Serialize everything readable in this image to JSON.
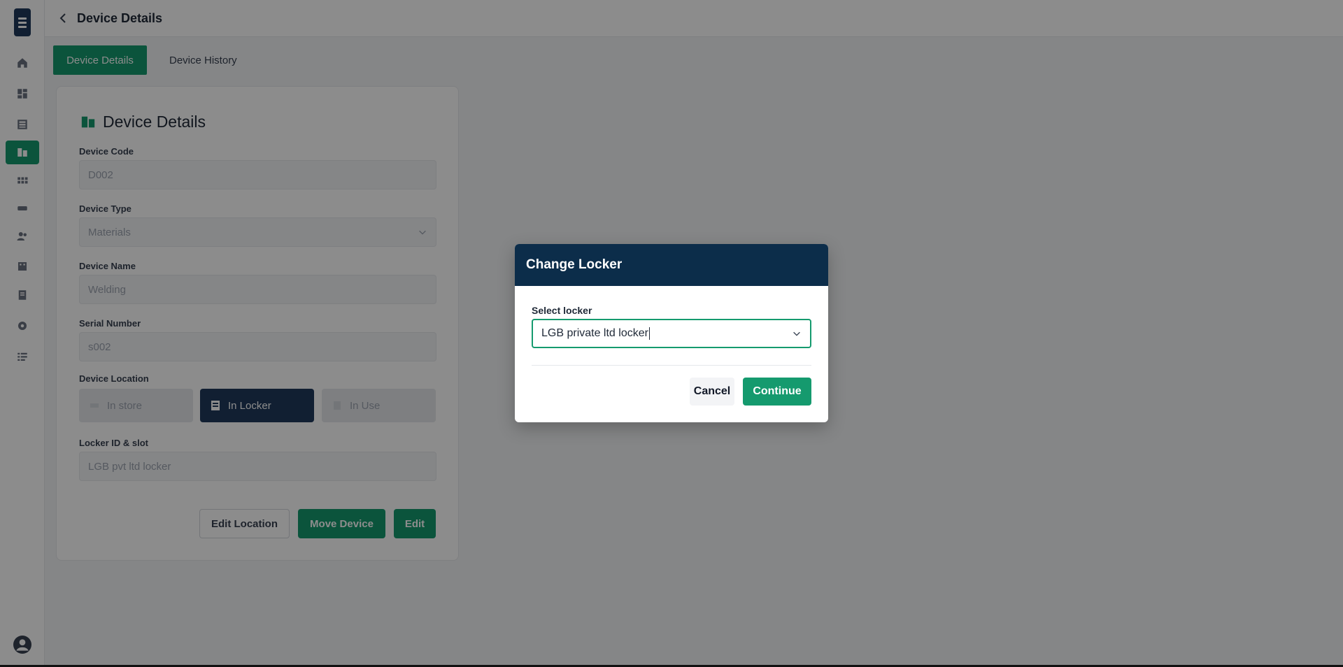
{
  "header": {
    "title": "Device Details"
  },
  "tabs": [
    {
      "label": "Device Details",
      "active": true
    },
    {
      "label": "Device History",
      "active": false
    }
  ],
  "sidebar": {
    "items": [
      {
        "icon": "home-icon"
      },
      {
        "icon": "dashboard-icon"
      },
      {
        "icon": "locker-icon"
      },
      {
        "icon": "devices-icon",
        "active": true
      },
      {
        "icon": "grid-icon"
      },
      {
        "icon": "card-icon"
      },
      {
        "icon": "users-icon"
      },
      {
        "icon": "building-icon"
      },
      {
        "icon": "document-icon"
      },
      {
        "icon": "gear-icon"
      },
      {
        "icon": "list-icon"
      }
    ]
  },
  "card": {
    "title": "Device Details",
    "fields": {
      "device_code": {
        "label": "Device Code",
        "value": "D002"
      },
      "device_type": {
        "label": "Device Type",
        "value": "Materials"
      },
      "device_name": {
        "label": "Device Name",
        "value": "Welding"
      },
      "serial_number": {
        "label": "Serial Number",
        "value": "s002"
      },
      "device_location": {
        "label": "Device Location",
        "options": [
          "In store",
          "In Locker",
          "In Use"
        ],
        "selected": "In Locker"
      },
      "locker_id": {
        "label": "Locker ID & slot",
        "value": "LGB pvt ltd locker"
      }
    },
    "buttons": {
      "edit_location": "Edit Location",
      "move_device": "Move Device",
      "edit": "Edit"
    }
  },
  "modal": {
    "title": "Change Locker",
    "select_label": "Select locker",
    "select_value": "LGB private ltd locker",
    "cancel": "Cancel",
    "continue": "Continue"
  },
  "colors": {
    "accent": "#159a6e",
    "navy": "#0c2d4a",
    "dark_blue": "#1f3a5c"
  }
}
